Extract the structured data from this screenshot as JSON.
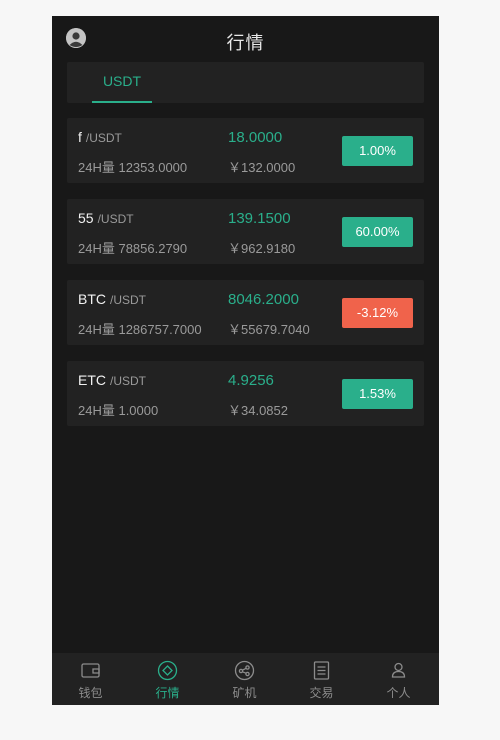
{
  "header": {
    "title": "行情"
  },
  "tabs": [
    {
      "label": "USDT",
      "active": true
    }
  ],
  "colors": {
    "up": "#2aaf8b",
    "down": "#f0634b",
    "background": "#181818",
    "card": "#222222"
  },
  "markets": [
    {
      "symbol": "f",
      "pair": "/USDT",
      "volume": "24H量 12353.0000",
      "price": "18.0000",
      "price_cny": "￥132.0000",
      "change": "1.00%",
      "direction": "up"
    },
    {
      "symbol": "55",
      "pair": "/USDT",
      "volume": "24H量 78856.2790",
      "price": "139.1500",
      "price_cny": "￥962.9180",
      "change": "60.00%",
      "direction": "up"
    },
    {
      "symbol": "BTC",
      "pair": "/USDT",
      "volume": "24H量 1286757.7000",
      "price": "8046.2000",
      "price_cny": "￥55679.7040",
      "change": "-3.12%",
      "direction": "down"
    },
    {
      "symbol": "ETC",
      "pair": "/USDT",
      "volume": "24H量 1.0000",
      "price": "4.9256",
      "price_cny": "￥34.0852",
      "change": "1.53%",
      "direction": "up"
    }
  ],
  "nav": [
    {
      "label": "钱包",
      "icon": "wallet-icon",
      "active": false
    },
    {
      "label": "行情",
      "icon": "market-icon",
      "active": true
    },
    {
      "label": "矿机",
      "icon": "miner-icon",
      "active": false
    },
    {
      "label": "交易",
      "icon": "trade-icon",
      "active": false
    },
    {
      "label": "个人",
      "icon": "user-icon",
      "active": false
    }
  ]
}
